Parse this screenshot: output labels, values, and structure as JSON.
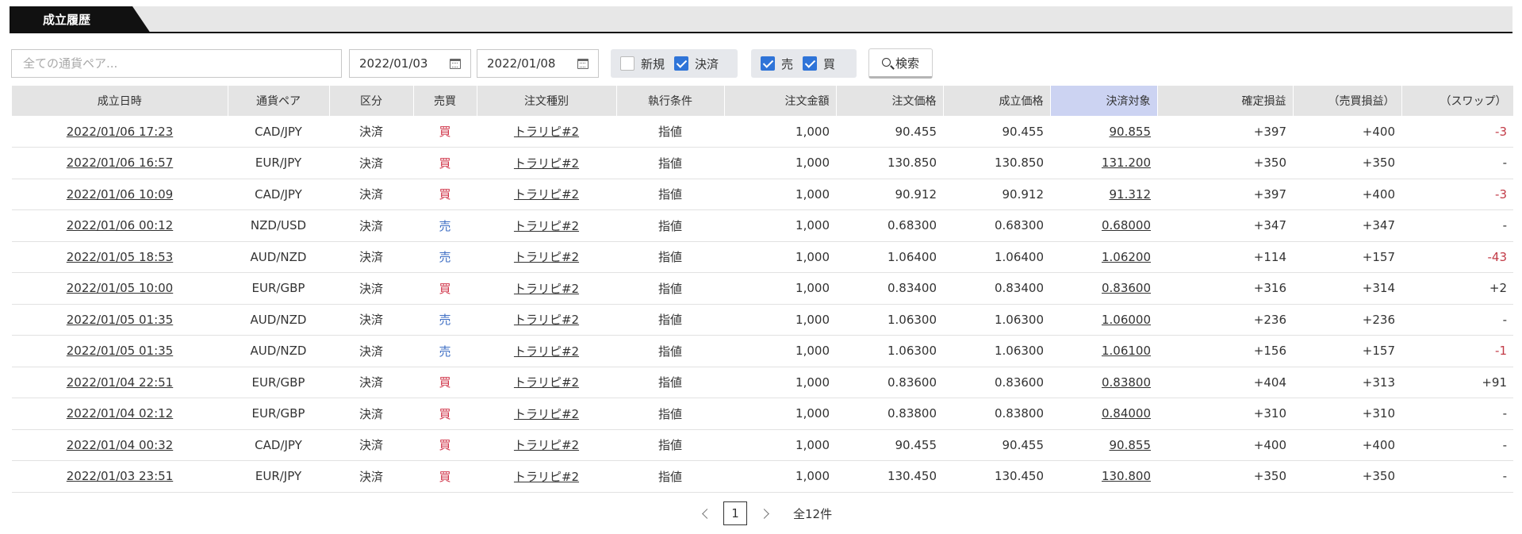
{
  "tab": {
    "label": "成立履歴"
  },
  "filters": {
    "pair_placeholder": "全ての通貨ペア...",
    "date_from": "2022/01/03",
    "date_to": "2022/01/08",
    "type_checks": [
      {
        "label": "新規",
        "checked": false
      },
      {
        "label": "決済",
        "checked": true
      }
    ],
    "side_checks": [
      {
        "label": "売",
        "checked": true
      },
      {
        "label": "買",
        "checked": true
      }
    ],
    "search_label": "検索"
  },
  "table": {
    "headers": [
      "成立日時",
      "通貨ペア",
      "区分",
      "売買",
      "注文種別",
      "執行条件",
      "注文金額",
      "注文価格",
      "成立価格",
      "決済対象",
      "確定損益",
      "（売買損益）",
      "（スワップ）"
    ],
    "rows": [
      [
        "2022/01/06 17:23",
        "CAD/JPY",
        "決済",
        "買",
        "トラリピ#2",
        "指値",
        "1,000",
        "90.455",
        "90.455",
        "90.855",
        "+397",
        "+400",
        "-3"
      ],
      [
        "2022/01/06 16:57",
        "EUR/JPY",
        "決済",
        "買",
        "トラリピ#2",
        "指値",
        "1,000",
        "130.850",
        "130.850",
        "131.200",
        "+350",
        "+350",
        "-"
      ],
      [
        "2022/01/06 10:09",
        "CAD/JPY",
        "決済",
        "買",
        "トラリピ#2",
        "指値",
        "1,000",
        "90.912",
        "90.912",
        "91.312",
        "+397",
        "+400",
        "-3"
      ],
      [
        "2022/01/06 00:12",
        "NZD/USD",
        "決済",
        "売",
        "トラリピ#2",
        "指値",
        "1,000",
        "0.68300",
        "0.68300",
        "0.68000",
        "+347",
        "+347",
        "-"
      ],
      [
        "2022/01/05 18:53",
        "AUD/NZD",
        "決済",
        "売",
        "トラリピ#2",
        "指値",
        "1,000",
        "1.06400",
        "1.06400",
        "1.06200",
        "+114",
        "+157",
        "-43"
      ],
      [
        "2022/01/05 10:00",
        "EUR/GBP",
        "決済",
        "買",
        "トラリピ#2",
        "指値",
        "1,000",
        "0.83400",
        "0.83400",
        "0.83600",
        "+316",
        "+314",
        "+2"
      ],
      [
        "2022/01/05 01:35",
        "AUD/NZD",
        "決済",
        "売",
        "トラリピ#2",
        "指値",
        "1,000",
        "1.06300",
        "1.06300",
        "1.06000",
        "+236",
        "+236",
        "-"
      ],
      [
        "2022/01/05 01:35",
        "AUD/NZD",
        "決済",
        "売",
        "トラリピ#2",
        "指値",
        "1,000",
        "1.06300",
        "1.06300",
        "1.06100",
        "+156",
        "+157",
        "-1"
      ],
      [
        "2022/01/04 22:51",
        "EUR/GBP",
        "決済",
        "買",
        "トラリピ#2",
        "指値",
        "1,000",
        "0.83600",
        "0.83600",
        "0.83800",
        "+404",
        "+313",
        "+91"
      ],
      [
        "2022/01/04 02:12",
        "EUR/GBP",
        "決済",
        "買",
        "トラリピ#2",
        "指値",
        "1,000",
        "0.83800",
        "0.83800",
        "0.84000",
        "+310",
        "+310",
        "-"
      ],
      [
        "2022/01/04 00:32",
        "CAD/JPY",
        "決済",
        "買",
        "トラリピ#2",
        "指値",
        "1,000",
        "90.455",
        "90.455",
        "90.855",
        "+400",
        "+400",
        "-"
      ],
      [
        "2022/01/03 23:51",
        "EUR/JPY",
        "決済",
        "買",
        "トラリピ#2",
        "指値",
        "1,000",
        "130.450",
        "130.450",
        "130.800",
        "+350",
        "+350",
        "-"
      ]
    ]
  },
  "pagination": {
    "current": "1",
    "total": "全12件"
  },
  "colors": {
    "buy": "#d0364a",
    "sell": "#3f6fc4",
    "negative": "#c23b47",
    "header_highlight": "#ccd3f2",
    "checkbox": "#2f74d8"
  }
}
